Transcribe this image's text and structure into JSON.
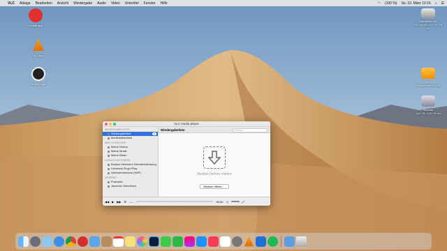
{
  "menubar": {
    "apple": "",
    "app": "VLC",
    "items": [
      "Ablage",
      "Bearbeiten",
      "Ansicht",
      "Wiedergabe",
      "Audio",
      "Video",
      "Untertitel",
      "Fenster",
      "Hilfe"
    ],
    "battery": "(100 %)",
    "clock": "So. 10. März 10:16"
  },
  "desktop_left": [
    {
      "label": "Vivaldi.app"
    },
    {
      "label": "VLC.app"
    },
    {
      "label": "Telefon.app"
    }
  ],
  "desktop_right": [
    {
      "label": "Macintosh HD",
      "sub": "499,96 GB, 371,31 GB frei"
    },
    {
      "label": "VLC",
      "sub": "Programme, 0,5 GB"
    },
    {
      "label": "Youtube",
      "sub": "4,61 TB, 3,35 TB frei"
    }
  ],
  "vlc": {
    "title": "VLC media player",
    "sections": [
      {
        "name": "Wiedergabelisten",
        "items": [
          {
            "label": "Wiedergabeliste",
            "badge": "0",
            "selected": true
          },
          {
            "label": "Medienbibliothek"
          }
        ]
      },
      {
        "name": "Mein Computer",
        "items": [
          {
            "label": "Meine Videos"
          },
          {
            "label": "Meine Musik"
          },
          {
            "label": "Meine Bilder"
          }
        ]
      },
      {
        "name": "Lokales Netzwerk",
        "items": [
          {
            "label": "Bonjour Netzwerk Dienstentdeckung"
          },
          {
            "label": "Universal Plug'n'Play"
          },
          {
            "label": "Netzwerkstreams (SAP)"
          }
        ]
      },
      {
        "name": "Internet",
        "items": [
          {
            "label": "Podcasts"
          },
          {
            "label": "Jamendo Selections"
          }
        ]
      }
    ],
    "header": "Wiedergabeliste",
    "search_placeholder": "Suchen",
    "drop_text": "Medien hierher ziehen",
    "open_button": "Medium öffnen …",
    "time_left": "--:--",
    "time_right": "00:00"
  },
  "colors": {
    "selection": "#2f73d8",
    "sky": "#7ea3c8",
    "sand": "#d9b27e"
  },
  "dock_icons": [
    "finder",
    "launchpad",
    "icloud",
    "safari",
    "chrome",
    "opera",
    "mail",
    "contacts",
    "calendar",
    "notes",
    "photos",
    "photoshop",
    "messages",
    "facetime",
    "itunes",
    "app-store",
    "music",
    "reminders",
    "system-preferences",
    "vlc",
    "keynote",
    "spotify",
    "trash"
  ]
}
